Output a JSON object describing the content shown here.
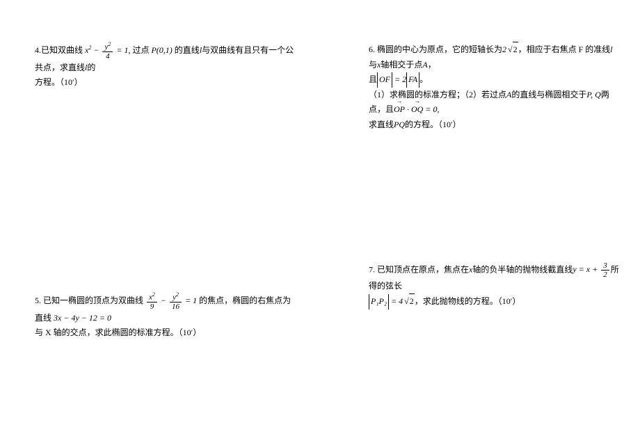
{
  "problems": {
    "p4": {
      "num": "4.",
      "text1": "已知双曲线",
      "eq_x2": "x",
      "eq_minus": " − ",
      "frac_num": "y",
      "frac_den": "4",
      "eq_eq1": " = 1, ",
      "text2": "过点",
      "point": "P(0,1)",
      "text3": "的直线",
      "line_l1": "l",
      "text4": "与双曲线有且只有一个公共点，求直线",
      "line_l2": "l",
      "text5": "的",
      "line2": "方程。（10′）"
    },
    "p5": {
      "num": "5. ",
      "text1": "已知一椭圆的顶点为双曲线",
      "frac1_num": "x",
      "frac1_den": "9",
      "minus": " − ",
      "frac2_num": "y",
      "frac2_den": "16",
      "eq": " = 1",
      "text2": "的焦点，椭圆的右焦点为直线",
      "line_eq": "3x − 4y − 12 = 0",
      "line2": "与 X 轴的交点，求此椭圆的标准方程。（10′）"
    },
    "p6": {
      "num": "6. ",
      "text1": "椭圆的中心为原点，它的短轴长为",
      "sqrt_pre": "2",
      "sqrt_val": "2",
      "text2": "，相应于右焦点 F 的准线",
      "line_l": "l",
      "text3": "与",
      "x_axis": "x",
      "text4": "轴相交于点",
      "pointA": "A",
      "text5": "，",
      "line2a": "且",
      "of": "OF",
      "eq_2": " = 2",
      "fa": "FA",
      "line2b": "。",
      "line3": "（1）求椭圆的标准方程；（2）若过点",
      "pointA2": "A",
      "text6": "的直线与椭圆相交于",
      "pq": "P, Q",
      "text7": "两点，且",
      "op": "OP",
      "dot": " · ",
      "oq": "OQ",
      "eq0": " = 0,",
      "line4": "求直线",
      "pq2": "PQ",
      "text8": "的方程。（10′）"
    },
    "p7": {
      "num": "7. ",
      "text1": "已知顶点在原点，焦点在",
      "x_axis": "x",
      "text2": "轴的负半轴的抛物线截直线",
      "y_eq": "y = x + ",
      "frac_num": "3",
      "frac_den": "2",
      "text3": "所得的弦长",
      "p1p2": "P₁P₂",
      "eq_4": " = 4",
      "sqrt_val": "2",
      "text4": "，求此抛物线的方程。（10′）"
    }
  }
}
